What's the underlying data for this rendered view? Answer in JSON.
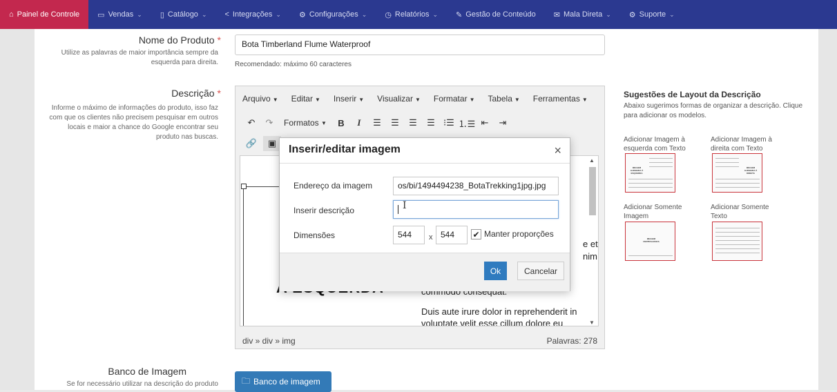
{
  "nav": {
    "items": [
      {
        "icon": "home-icon",
        "glyph": "⌂",
        "label": "Painel de Controle",
        "active": true,
        "chevron": false
      },
      {
        "icon": "folder-icon",
        "glyph": "▭",
        "label": "Vendas",
        "active": false,
        "chevron": true
      },
      {
        "icon": "book-icon",
        "glyph": "▯",
        "label": "Catálogo",
        "active": false,
        "chevron": true
      },
      {
        "icon": "share-icon",
        "glyph": "<",
        "label": "Integrações",
        "active": false,
        "chevron": true
      },
      {
        "icon": "gear-icon",
        "glyph": "⚙",
        "label": "Configurações",
        "active": false,
        "chevron": true
      },
      {
        "icon": "history-icon",
        "glyph": "◷",
        "label": "Relatórios",
        "active": false,
        "chevron": true
      },
      {
        "icon": "edit-icon",
        "glyph": "✎",
        "label": "Gestão de Conteúdo",
        "active": false,
        "chevron": false
      },
      {
        "icon": "mail-icon",
        "glyph": "✉",
        "label": "Mala Direta",
        "active": false,
        "chevron": true
      },
      {
        "icon": "support-icon",
        "glyph": "⚙",
        "label": "Suporte",
        "active": false,
        "chevron": true
      }
    ],
    "chevron": "⌄"
  },
  "product": {
    "name_label": "Nome do Produto",
    "required": "*",
    "name_help": "Utilize as palavras de maior importância sempre da esquerda para direita.",
    "name_value": "Bota Timberland Flume Waterproof",
    "name_hint": "Recomendado: máximo 60 caracteres",
    "desc_label": "Descrição",
    "desc_help": "Informe o máximo de informações do produto, isso faz com que os clientes não precisem pesquisar em outros locais e maior a chance do Google encontrar seu produto nas buscas."
  },
  "editor": {
    "menus": [
      "Arquivo",
      "Editar",
      "Inserir",
      "Visualizar",
      "Formatar",
      "Tabela",
      "Ferramentas"
    ],
    "formats_label": "Formatos",
    "big_text": "A ESQUERDA",
    "para1": "commodo consequat.",
    "para2": "Duis aute irure dolor in reprehenderit in voluptate velit esse cillum dolore eu",
    "frag1": "e et",
    "frag2": "nim",
    "path": "div » div » img",
    "words": "Palavras: 278"
  },
  "suggestions": {
    "title": "Sugestões de Layout da Descrição",
    "desc": "Abaixo sugerimos formas de organizar a descrição. Clique para adicionar os modelos.",
    "items": [
      {
        "label": "Adicionar Imagem à esquerda com Texto",
        "thumb": "IMAGEM ALINHADA À ESQUERDA"
      },
      {
        "label": "Adicionar Imagem à direita com Texto",
        "thumb": "IMAGEM ALINHADA À DIREITA"
      },
      {
        "label": "Adicionar Somente Imagem",
        "thumb": "IMAGEM CENTRALIZADA"
      },
      {
        "label": "Adicionar Somente Texto",
        "thumb": ""
      }
    ]
  },
  "bank": {
    "label": "Banco de Imagem",
    "help": "Se for necessário utilizar na descrição do produto",
    "button": "Banco de imagem"
  },
  "modal": {
    "title": "Inserir/editar imagem",
    "close": "×",
    "src_label": "Endereço da imagem",
    "src_value": "os/bi/1494494238_BotaTrekking1jpg.jpg",
    "alt_label": "Inserir descrição",
    "alt_value": "",
    "dim_label": "Dimensões",
    "width": "544",
    "height": "544",
    "times": "x",
    "keep_label": "Manter proporções",
    "ok": "Ok",
    "cancel": "Cancelar"
  }
}
